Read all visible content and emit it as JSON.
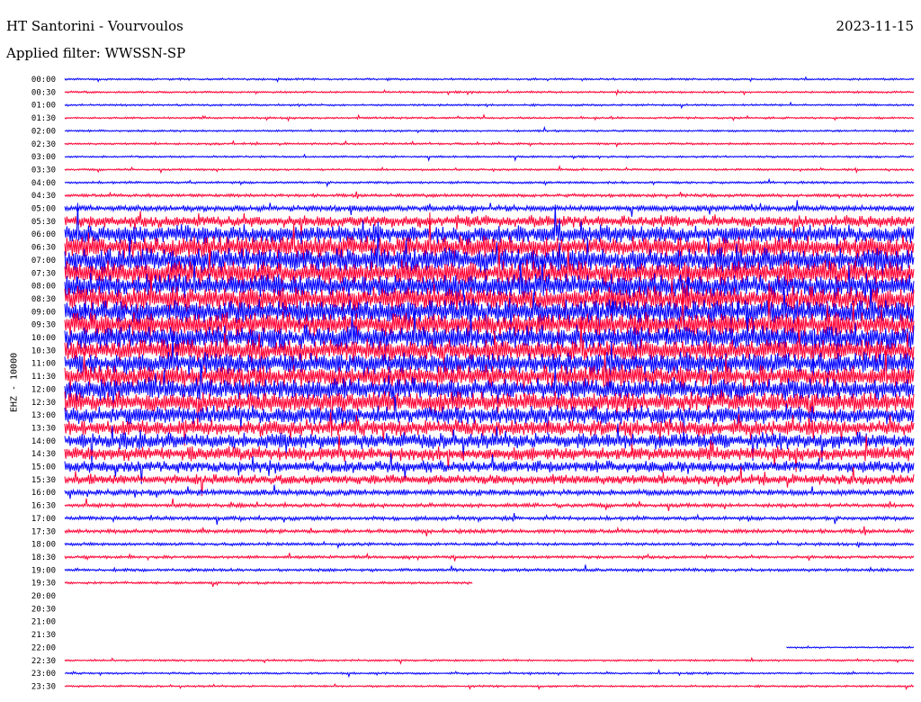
{
  "header": {
    "title": "HT Santorini - Vourvoulos",
    "date": "2023-11-15",
    "filter": "Applied filter: WWSSN-SP"
  },
  "chart_data": {
    "type": "line",
    "title": "HT Santorini - Vourvoulos",
    "ylabel": "EHZ - 10000",
    "xlabel": "",
    "colors": {
      "odd": "#0000ff",
      "even": "#ff0033"
    },
    "time_labels": [
      "00:00",
      "00:30",
      "01:00",
      "01:30",
      "02:00",
      "02:30",
      "03:00",
      "03:30",
      "04:00",
      "04:30",
      "05:00",
      "05:30",
      "06:00",
      "06:30",
      "07:00",
      "07:30",
      "08:00",
      "08:30",
      "09:00",
      "09:30",
      "10:00",
      "10:30",
      "11:00",
      "11:30",
      "12:00",
      "12:30",
      "13:00",
      "13:30",
      "14:00",
      "14:30",
      "15:00",
      "15:30",
      "16:00",
      "16:30",
      "17:00",
      "17:30",
      "18:00",
      "18:30",
      "19:00",
      "19:30",
      "20:00",
      "20:30",
      "21:00",
      "21:30",
      "22:00",
      "22:30",
      "23:00",
      "23:30"
    ],
    "amplitude": [
      1,
      1,
      1,
      1,
      1,
      1,
      1,
      1,
      1.2,
      1.6,
      3,
      6,
      9,
      11,
      12,
      12,
      12,
      12,
      12,
      12,
      12,
      11,
      11,
      11,
      11,
      10,
      9,
      8,
      8,
      7,
      6,
      5,
      3,
      2,
      2,
      2,
      1.5,
      1.5,
      1.5,
      1.2,
      0,
      0,
      0,
      0,
      0.8,
      1,
      1,
      1
    ],
    "data_extent": [
      1,
      1,
      1,
      1,
      1,
      1,
      1,
      1,
      1,
      1,
      1,
      1,
      1,
      1,
      1,
      1,
      1,
      1,
      1,
      1,
      1,
      1,
      1,
      1,
      1,
      1,
      1,
      1,
      1,
      1,
      1,
      1,
      1,
      1,
      1,
      1,
      1,
      1,
      1,
      0.48,
      0,
      0,
      0,
      0,
      0.15,
      1,
      1,
      1
    ],
    "data_start": [
      0,
      0,
      0,
      0,
      0,
      0,
      0,
      0,
      0,
      0,
      0,
      0,
      0,
      0,
      0,
      0,
      0,
      0,
      0,
      0,
      0,
      0,
      0,
      0,
      0,
      0,
      0,
      0,
      0,
      0,
      0,
      0,
      0,
      0,
      0,
      0,
      0,
      0,
      0,
      0,
      0,
      0,
      0,
      0,
      0.85,
      0,
      0,
      0
    ]
  }
}
